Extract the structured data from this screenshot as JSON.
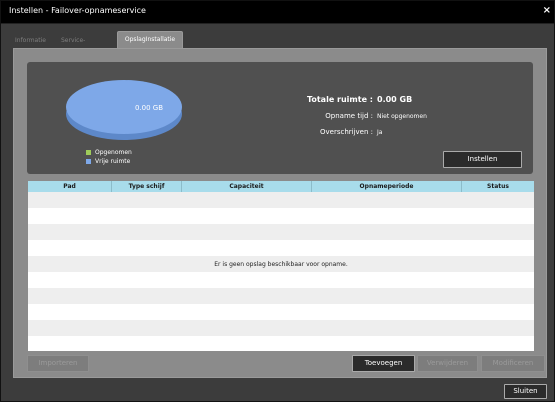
{
  "window": {
    "title": "Instellen - Failover-opnameservice",
    "close_glyph": "×"
  },
  "tabs": [
    {
      "label": "Informatie"
    },
    {
      "label": "Service-instelling"
    },
    {
      "label": "OpslagInstallatie"
    }
  ],
  "summary": {
    "pie_label": "0.00 GB",
    "legend": [
      {
        "label": "Opgenomen",
        "color": "#9ecb5a"
      },
      {
        "label": "Vrije ruimte",
        "color": "#7ea8e8"
      }
    ],
    "total_label": "Totale ruimte :",
    "total_value": "0.00 GB",
    "rec_time_label": "Opname tijd :",
    "rec_time_value": "Niet opgenomen",
    "overwrite_label": "Overschrijven :",
    "overwrite_value": "Ja",
    "setup_button": "Instellen"
  },
  "table": {
    "columns": [
      "Pad",
      "Type schijf",
      "Capaciteit",
      "Opnameperiode",
      "Status"
    ],
    "empty_message": "Er is geen opslag beschikbaar voor opname."
  },
  "actions": {
    "import": "Importeren",
    "add": "Toevoegen",
    "remove": "Verwijderen",
    "modify": "Modificeren",
    "close": "Sluiten"
  },
  "colors": {
    "pie_free": "#7ea8e8",
    "header_bg": "#a8dceb"
  }
}
